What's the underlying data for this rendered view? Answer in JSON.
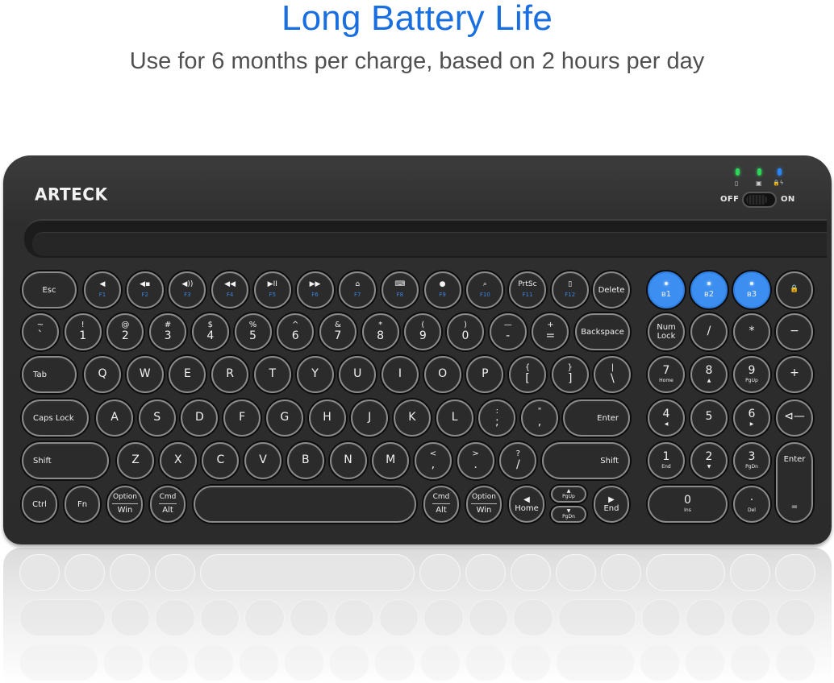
{
  "header": {
    "title": "Long Battery Life",
    "subtitle": "Use for 6 months per charge, based on 2 hours per day"
  },
  "keyboard": {
    "brand": "ARTECK",
    "indicators": [
      {
        "name": "caps-lock-indicator",
        "color": "#2fd35a",
        "icon": "▯"
      },
      {
        "name": "num-lock-indicator",
        "color": "#2fd35a",
        "icon": "▣"
      },
      {
        "name": "battery-charge-indicator",
        "color": "#2a86f5",
        "icon": "🔒ϟ"
      }
    ],
    "switch": {
      "off_label": "OFF",
      "on_label": "ON",
      "state": "on"
    },
    "colors": {
      "accent_blue": "#3d8ef1",
      "fn_label_blue": "#3d84e0",
      "body": "#2b2b2b"
    },
    "row1": [
      {
        "label": "Esc"
      },
      {
        "icon": "◀",
        "fn": "F1"
      },
      {
        "icon": "◀▪",
        "fn": "F2"
      },
      {
        "icon": "◀))",
        "fn": "F3"
      },
      {
        "icon": "◀◀",
        "fn": "F4"
      },
      {
        "icon": "▶II",
        "fn": "F5"
      },
      {
        "icon": "▶▶",
        "fn": "F6"
      },
      {
        "icon": "⌂",
        "fn": "F7"
      },
      {
        "icon": "⌨",
        "fn": "F8"
      },
      {
        "icon": "●",
        "fn": "F9"
      },
      {
        "icon": "⌕",
        "fn": "F10"
      },
      {
        "icon": "PrtSc",
        "fn": "F11"
      },
      {
        "icon": "▯",
        "fn": "F12"
      },
      {
        "label": "Delete"
      }
    ],
    "bt_keys": [
      {
        "label": "ʙ1"
      },
      {
        "label": "ʙ2"
      },
      {
        "label": "ʙ3"
      }
    ],
    "lock_key": {
      "icon": "🔒"
    },
    "row2": [
      {
        "top": "~",
        "bot": "`"
      },
      {
        "top": "!",
        "bot": "1"
      },
      {
        "top": "@",
        "bot": "2"
      },
      {
        "top": "#",
        "bot": "3"
      },
      {
        "top": "$",
        "bot": "4"
      },
      {
        "top": "%",
        "bot": "5"
      },
      {
        "top": "^",
        "bot": "6"
      },
      {
        "top": "&",
        "bot": "7"
      },
      {
        "top": "*",
        "bot": "8"
      },
      {
        "top": "(",
        "bot": "9"
      },
      {
        "top": ")",
        "bot": "0"
      },
      {
        "top": "—",
        "bot": "-"
      },
      {
        "top": "+",
        "bot": "="
      },
      {
        "label": "Backspace"
      }
    ],
    "row3": [
      {
        "label": "Tab"
      },
      {
        "label": "Q"
      },
      {
        "label": "W"
      },
      {
        "label": "E"
      },
      {
        "label": "R"
      },
      {
        "label": "T"
      },
      {
        "label": "Y"
      },
      {
        "label": "U"
      },
      {
        "label": "I"
      },
      {
        "label": "O"
      },
      {
        "label": "P"
      },
      {
        "top": "{",
        "bot": "["
      },
      {
        "top": "}",
        "bot": "]"
      },
      {
        "top": "|",
        "bot": "\\"
      }
    ],
    "row4": [
      {
        "label": "Caps Lock"
      },
      {
        "label": "A"
      },
      {
        "label": "S"
      },
      {
        "label": "D"
      },
      {
        "label": "F"
      },
      {
        "label": "G"
      },
      {
        "label": "H"
      },
      {
        "label": "J"
      },
      {
        "label": "K"
      },
      {
        "label": "L"
      },
      {
        "top": ":",
        "bot": ";"
      },
      {
        "top": "\"",
        "bot": ","
      },
      {
        "label": "Enter"
      }
    ],
    "row5": [
      {
        "label": "Shift"
      },
      {
        "label": "Z"
      },
      {
        "label": "X"
      },
      {
        "label": "C"
      },
      {
        "label": "V"
      },
      {
        "label": "B"
      },
      {
        "label": "N"
      },
      {
        "label": "M"
      },
      {
        "top": "<",
        "bot": ","
      },
      {
        "top": ">",
        "bot": "."
      },
      {
        "top": "?",
        "bot": "/"
      },
      {
        "label": "Shift"
      }
    ],
    "row6": [
      {
        "label": "Ctrl"
      },
      {
        "label": "Fn"
      },
      {
        "top": "Option",
        "bot": "Win"
      },
      {
        "top": "Cmd",
        "bot": "Alt"
      },
      {
        "label": ""
      },
      {
        "top": "Cmd",
        "bot": "Alt"
      },
      {
        "top": "Option",
        "bot": "Win"
      },
      {
        "arrow": "◀",
        "label": "Home"
      },
      {
        "arrow": "▲",
        "label": "PgUp"
      },
      {
        "arrow": "▼",
        "label": "PgDn"
      },
      {
        "arrow": "▶",
        "label": "End"
      }
    ],
    "numpad": {
      "row2": [
        {
          "top": "Num",
          "bot": "Lock"
        },
        {
          "label": "/"
        },
        {
          "label": "*"
        },
        {
          "label": "−"
        }
      ],
      "row3": [
        {
          "main": "7",
          "sub": "Home"
        },
        {
          "main": "8",
          "sub": "▲"
        },
        {
          "main": "9",
          "sub": "PgUp"
        },
        {
          "main": "+"
        }
      ],
      "row4": [
        {
          "main": "4",
          "sub": "◀"
        },
        {
          "main": "5"
        },
        {
          "main": "6",
          "sub": "▶"
        },
        {
          "main": "⊲—"
        }
      ],
      "row5": [
        {
          "main": "1",
          "sub": "End"
        },
        {
          "main": "2",
          "sub": "▼"
        },
        {
          "main": "3",
          "sub": "PgDn"
        }
      ],
      "enter": {
        "top": "Enter",
        "bot": "="
      },
      "row6": [
        {
          "main": "0",
          "sub": "Ins"
        },
        {
          "main": "·",
          "sub": "Del"
        }
      ]
    }
  }
}
